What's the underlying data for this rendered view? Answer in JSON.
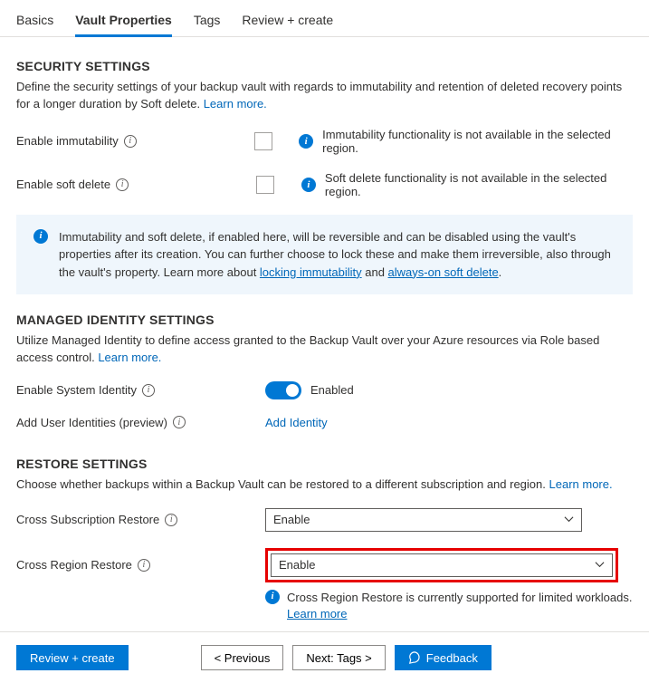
{
  "tabs": {
    "basics": "Basics",
    "vault_properties": "Vault Properties",
    "tags": "Tags",
    "review": "Review + create"
  },
  "security": {
    "heading": "SECURITY SETTINGS",
    "desc": "Define the security settings of your backup vault with regards to immutability and retention of deleted recovery points for a longer duration by Soft delete.",
    "learn_more": "Learn more.",
    "immutability_label": "Enable immutability",
    "immutability_msg": "Immutability functionality is not available in the selected region.",
    "softdelete_label": "Enable soft delete",
    "softdelete_msg": "Soft delete functionality is not available in the selected region.",
    "banner_pre": "Immutability and soft delete, if enabled here, will be reversible and can be disabled using the vault's properties after its creation. You can further choose to lock these and make them irreversible, also through the vault's property. Learn more about ",
    "banner_link1": "locking immutability",
    "banner_mid": " and ",
    "banner_link2": "always-on soft delete",
    "banner_post": "."
  },
  "identity": {
    "heading": "MANAGED IDENTITY SETTINGS",
    "desc": "Utilize Managed Identity to define access granted to the Backup Vault over your Azure resources via Role based access control.",
    "learn_more": "Learn more.",
    "system_identity_label": "Enable System Identity",
    "enabled_text": "Enabled",
    "add_user_label": "Add User Identities (preview)",
    "add_identity": "Add Identity"
  },
  "restore": {
    "heading": "RESTORE SETTINGS",
    "desc": "Choose whether backups within a Backup Vault can be restored to a different subscription and region.",
    "learn_more": "Learn more.",
    "cross_sub_label": "Cross Subscription Restore",
    "cross_sub_value": "Enable",
    "cross_region_label": "Cross Region Restore",
    "cross_region_value": "Enable",
    "crr_info": "Cross Region Restore is currently supported for limited workloads. ",
    "crr_link": "Learn more"
  },
  "footer": {
    "review": "Review + create",
    "previous": "< Previous",
    "next": "Next: Tags >",
    "feedback": "Feedback"
  }
}
